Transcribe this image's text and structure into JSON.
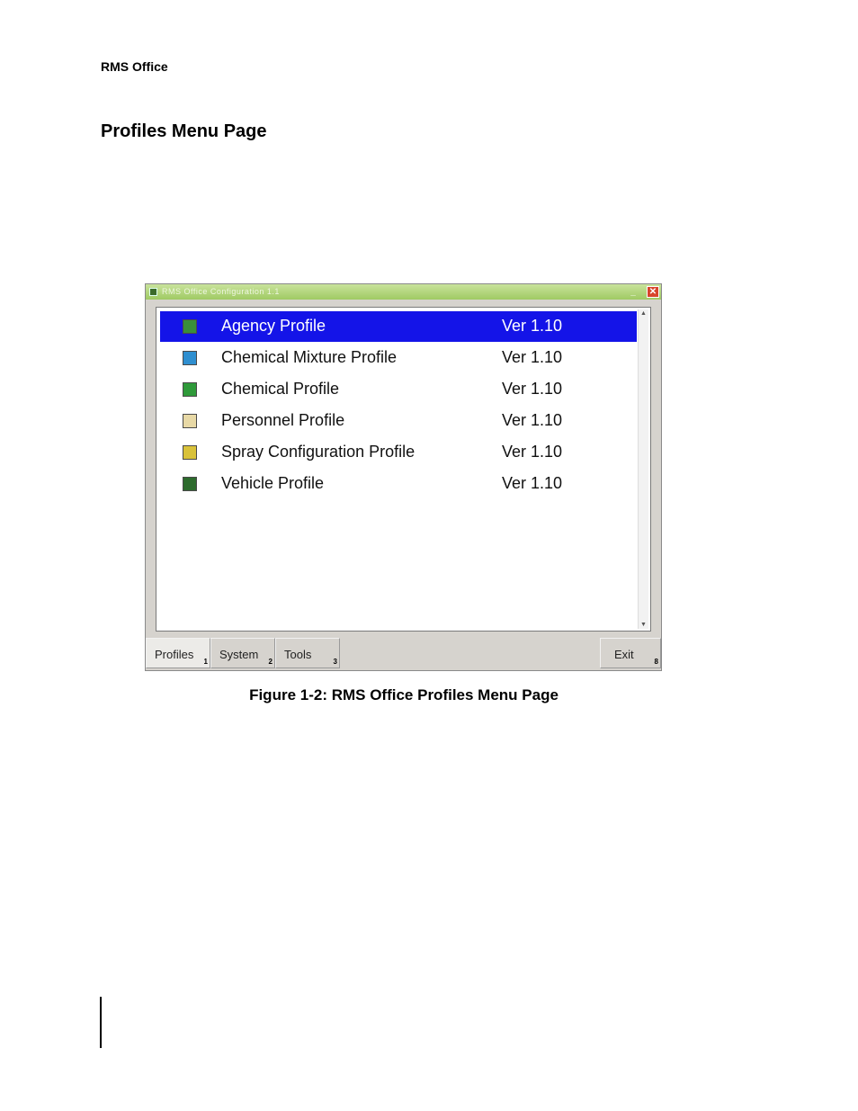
{
  "header": {
    "running_title": "RMS Office"
  },
  "section": {
    "title": "Profiles Menu Page"
  },
  "window": {
    "title": "RMS Office Configuration 1.1",
    "profiles": [
      {
        "label": "Agency Profile",
        "version": "Ver 1.10",
        "icon": "agency-profile-icon",
        "selected": true
      },
      {
        "label": "Chemical Mixture Profile",
        "version": "Ver 1.10",
        "icon": "chemical-mixture-icon",
        "selected": false
      },
      {
        "label": "Chemical Profile",
        "version": "Ver 1.10",
        "icon": "chemical-icon",
        "selected": false
      },
      {
        "label": "Personnel Profile",
        "version": "Ver 1.10",
        "icon": "personnel-icon",
        "selected": false
      },
      {
        "label": "Spray Configuration Profile",
        "version": "Ver 1.10",
        "icon": "spray-configuration-icon",
        "selected": false
      },
      {
        "label": "Vehicle Profile",
        "version": "Ver 1.10",
        "icon": "vehicle-icon",
        "selected": false
      }
    ],
    "tabs": [
      {
        "label": "Profiles",
        "shortcut": "1"
      },
      {
        "label": "System",
        "shortcut": "2"
      },
      {
        "label": "Tools",
        "shortcut": "3"
      },
      {
        "label": "Exit",
        "shortcut": "8"
      }
    ]
  },
  "caption": {
    "text": "Figure 1-2: RMS Office Profiles Menu Page"
  },
  "colors": {
    "selection": "#1414e8",
    "window_bg": "#d6d3ce",
    "titlebar": "#9fca63"
  }
}
